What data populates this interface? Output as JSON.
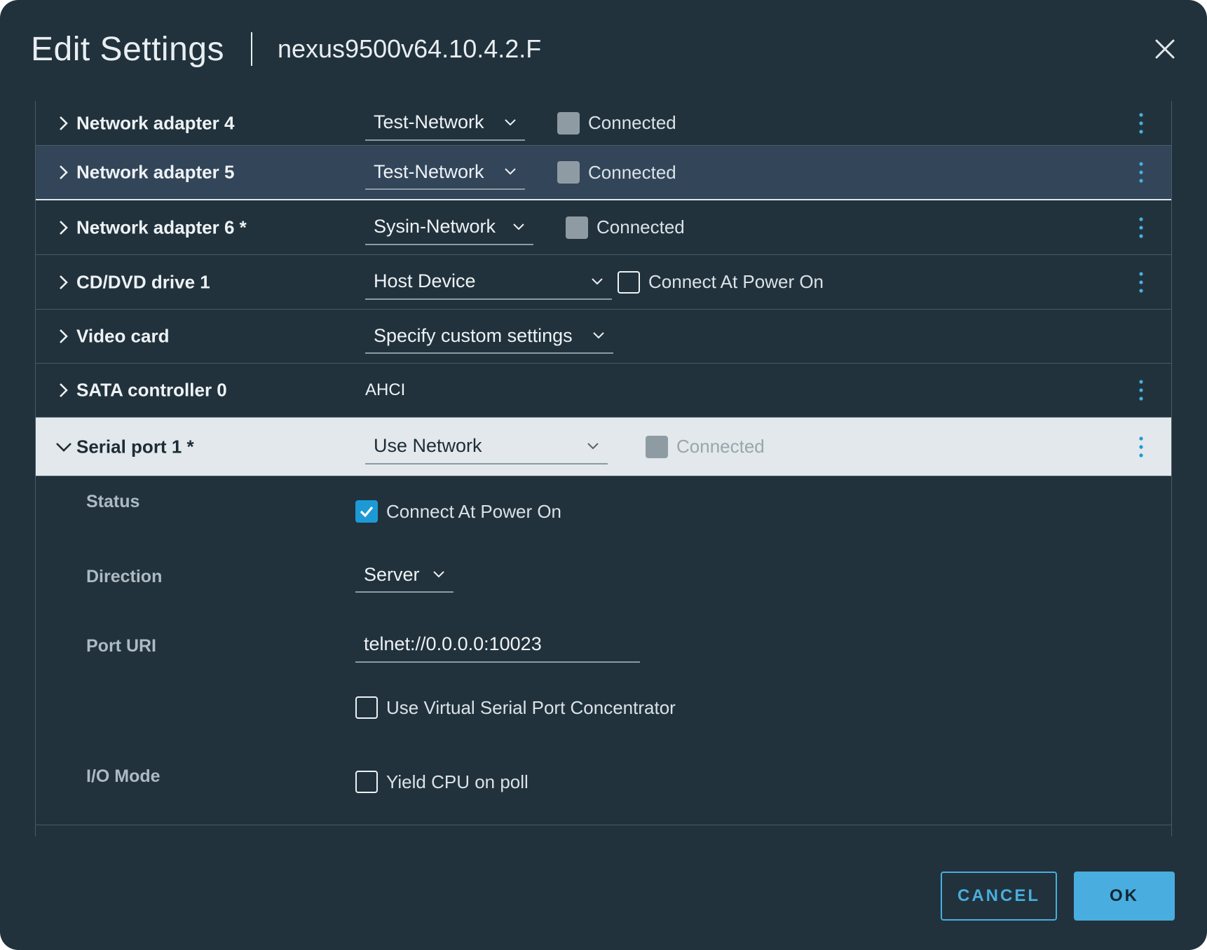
{
  "dialog": {
    "title": "Edit Settings",
    "subtitle": "nexus9500v64.10.4.2.F",
    "close_icon": "close-icon"
  },
  "rows": {
    "na4": {
      "label": "Network adapter 4",
      "network": "Test-Network",
      "status": "Connected"
    },
    "na5": {
      "label": "Network adapter 5",
      "network": "Test-Network",
      "status": "Connected"
    },
    "na6": {
      "label": "Network adapter 6 *",
      "network": "Sysin-Network",
      "status": "Connected"
    },
    "cd": {
      "label": "CD/DVD drive 1",
      "device": "Host Device",
      "power_on": "Connect At Power On"
    },
    "video": {
      "label": "Video card",
      "setting": "Specify custom settings"
    },
    "sata": {
      "label": "SATA controller 0",
      "value": "AHCI"
    },
    "serial": {
      "label": "Serial port 1 *",
      "type": "Use Network",
      "status": "Connected"
    }
  },
  "serial_detail": {
    "status_label": "Status",
    "status_option": "Connect At Power On",
    "direction_label": "Direction",
    "direction_value": "Server",
    "port_uri_label": "Port URI",
    "port_uri_value": "telnet://0.0.0.0:10023",
    "vspc_option": "Use Virtual Serial Port Concentrator",
    "io_mode_label": "I/O Mode",
    "io_mode_option": "Yield CPU on poll"
  },
  "footer": {
    "cancel_label": "CANCEL",
    "ok_label": "OK"
  },
  "colors": {
    "background": "#21323c",
    "accent": "#49aedf",
    "checkbox_checked": "#1d9ad6",
    "selected_row": "#324559",
    "expanded_row": "#e2e8eb"
  }
}
